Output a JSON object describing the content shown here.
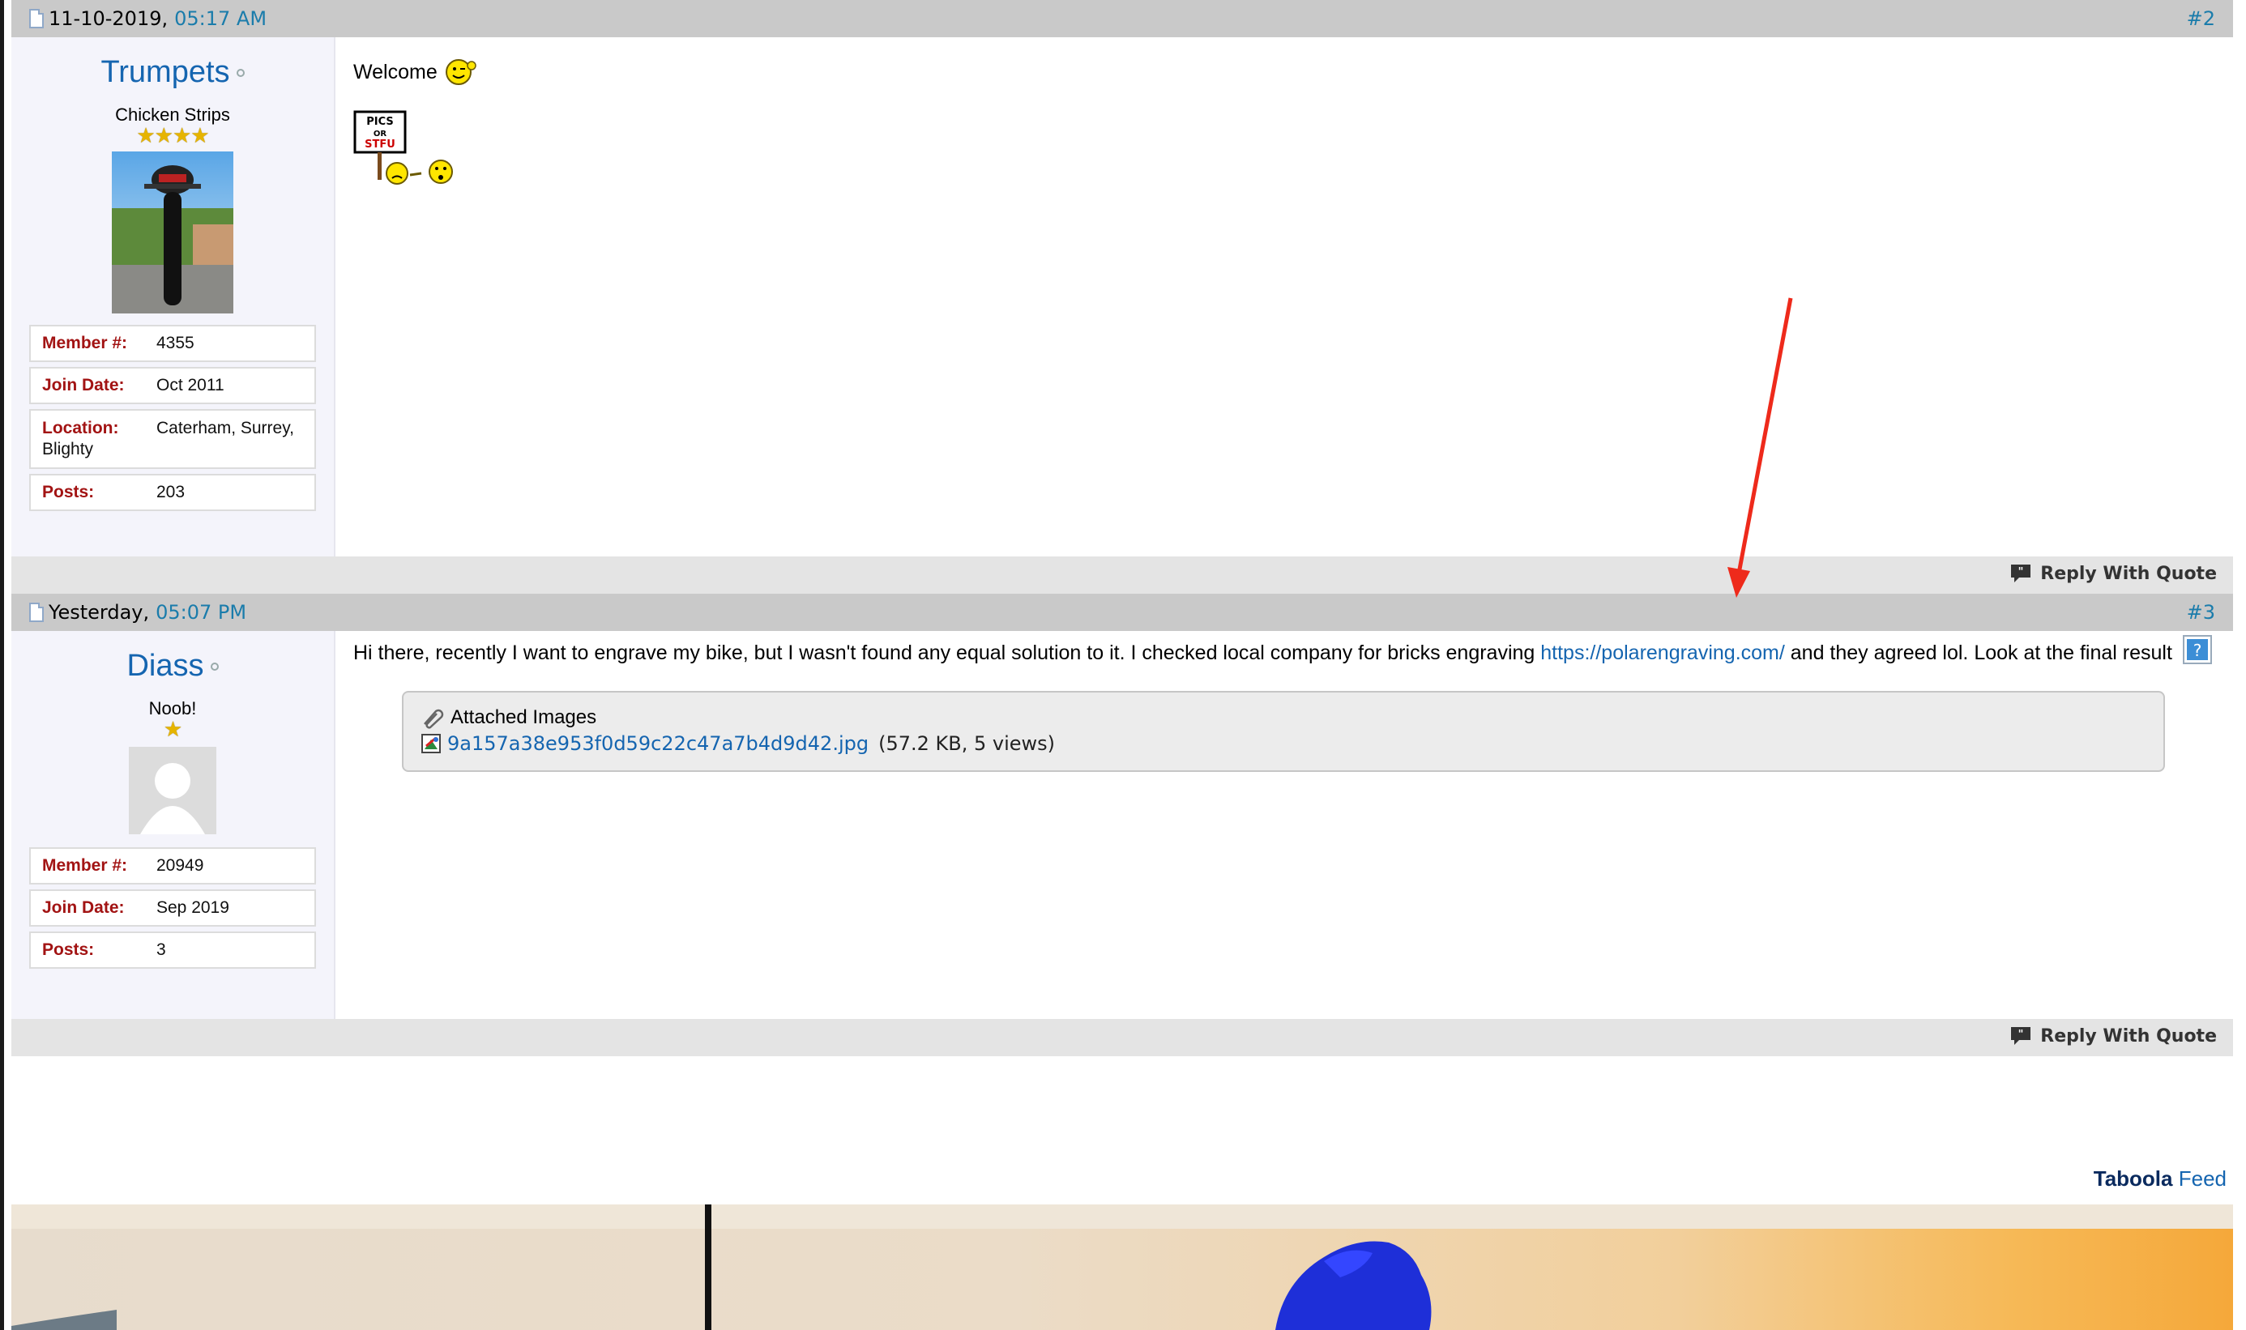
{
  "posts": [
    {
      "date": "11-10-2019,",
      "time": "05:17 AM",
      "number": "#2",
      "username": "Trumpets",
      "user_title": "Chicken Strips",
      "stars": "★★★★",
      "stats": [
        {
          "label": "Member #:",
          "value": "4355"
        },
        {
          "label": "Join Date:",
          "value": "Oct 2011"
        },
        {
          "label": "Location:",
          "value": "Caterham, Surrey, Blighty"
        },
        {
          "label": "Posts:",
          "value": "203"
        }
      ],
      "message": "Welcome",
      "sign_text": [
        "PICS",
        "OR",
        "STFU"
      ],
      "reply_label": "Reply With Quote"
    },
    {
      "date": "Yesterday,",
      "time": "05:07 PM",
      "number": "#3",
      "username": "Diass",
      "user_title": "Noob!",
      "stars": "★",
      "stats": [
        {
          "label": "Member #:",
          "value": "20949"
        },
        {
          "label": "Join Date:",
          "value": "Sep 2019"
        },
        {
          "label": "Posts:",
          "value": "3"
        }
      ],
      "message_before_link": "Hi there, recently I want to engrave my bike, but I wasn't found any equal solution to it. I checked local company for bricks engraving ",
      "message_link": "https://polarengraving.com/",
      "message_after_link": " and they agreed lol. Look at the final result",
      "attachments_title": "Attached Images",
      "attachment_file": "9a157a38e953f0d59c22c47a7b4d9d42.jpg",
      "attachment_meta": "(57.2 KB, 5 views)",
      "reply_label": "Reply With Quote"
    }
  ],
  "taboola": {
    "brand": "Taboola",
    "feed": "Feed"
  },
  "colors": {
    "link": "#1565b0",
    "label": "#a21313",
    "header_bar": "#c9c9c9",
    "annotation_arrow": "#ee2a1b"
  }
}
